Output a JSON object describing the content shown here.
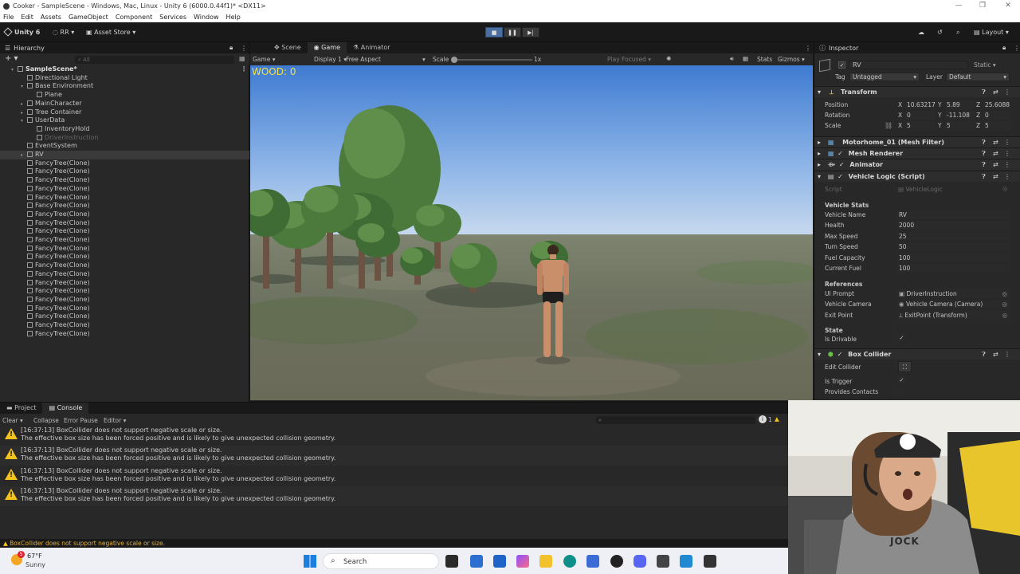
{
  "window": {
    "title": "Cooker - SampleScene - Windows, Mac, Linux - Unity 6 (6000.0.44f1)* <DX11>",
    "controls": [
      "—",
      "❐",
      "✕"
    ]
  },
  "menu": [
    "File",
    "Edit",
    "Assets",
    "GameObject",
    "Component",
    "Services",
    "Window",
    "Help"
  ],
  "toolbar": {
    "unity_label": "Unity 6",
    "account": "RR",
    "asset_store": "Asset Store",
    "layout": "Layout"
  },
  "hierarchy": {
    "tab": "Hierarchy",
    "search_placeholder": "All",
    "items": [
      {
        "label": "SampleScene*",
        "depth": 0,
        "dim": false
      },
      {
        "label": "Directional Light",
        "depth": 1,
        "dim": false
      },
      {
        "label": "Base Environment",
        "depth": 1,
        "dim": false
      },
      {
        "label": "Plane",
        "depth": 2,
        "dim": false
      },
      {
        "label": "MainCharacter",
        "depth": 1,
        "dim": false
      },
      {
        "label": "Tree Container",
        "depth": 1,
        "dim": false
      },
      {
        "label": "UserData",
        "depth": 1,
        "dim": false
      },
      {
        "label": "InventoryHold",
        "depth": 2,
        "dim": false
      },
      {
        "label": "DriverInstruction",
        "depth": 2,
        "dim": true
      },
      {
        "label": "EventSystem",
        "depth": 1,
        "dim": false
      },
      {
        "label": "RV",
        "depth": 1,
        "dim": false,
        "selected": true
      },
      {
        "label": "FancyTree(Clone)",
        "depth": 1,
        "dim": false
      },
      {
        "label": "FancyTree(Clone)",
        "depth": 1,
        "dim": false
      },
      {
        "label": "FancyTree(Clone)",
        "depth": 1,
        "dim": false
      },
      {
        "label": "FancyTree(Clone)",
        "depth": 1,
        "dim": false
      },
      {
        "label": "FancyTree(Clone)",
        "depth": 1,
        "dim": false
      },
      {
        "label": "FancyTree(Clone)",
        "depth": 1,
        "dim": false
      },
      {
        "label": "FancyTree(Clone)",
        "depth": 1,
        "dim": false
      },
      {
        "label": "FancyTree(Clone)",
        "depth": 1,
        "dim": false
      },
      {
        "label": "FancyTree(Clone)",
        "depth": 1,
        "dim": false
      },
      {
        "label": "FancyTree(Clone)",
        "depth": 1,
        "dim": false
      },
      {
        "label": "FancyTree(Clone)",
        "depth": 1,
        "dim": false
      },
      {
        "label": "FancyTree(Clone)",
        "depth": 1,
        "dim": false
      },
      {
        "label": "FancyTree(Clone)",
        "depth": 1,
        "dim": false
      },
      {
        "label": "FancyTree(Clone)",
        "depth": 1,
        "dim": false
      },
      {
        "label": "FancyTree(Clone)",
        "depth": 1,
        "dim": false
      },
      {
        "label": "FancyTree(Clone)",
        "depth": 1,
        "dim": false
      },
      {
        "label": "FancyTree(Clone)",
        "depth": 1,
        "dim": false
      },
      {
        "label": "FancyTree(Clone)",
        "depth": 1,
        "dim": false
      },
      {
        "label": "FancyTree(Clone)",
        "depth": 1,
        "dim": false
      },
      {
        "label": "FancyTree(Clone)",
        "depth": 1,
        "dim": false
      },
      {
        "label": "FancyTree(Clone)",
        "depth": 1,
        "dim": false
      }
    ]
  },
  "center_tabs": {
    "scene": "Scene",
    "game": "Game",
    "animator": "Animator"
  },
  "game_bar": {
    "mode": "Game",
    "display": "Display 1",
    "aspect": "Free Aspect",
    "scale_label": "Scale",
    "scale_value": "1x",
    "play_focused": "Play Focused",
    "stats": "Stats",
    "gizmos": "Gizmos"
  },
  "hud": {
    "wood": "WOOD: 0"
  },
  "inspector": {
    "tab": "Inspector",
    "object_name": "RV",
    "static_label": "Static",
    "tag_label": "Tag",
    "tag_value": "Untagged",
    "layer_label": "Layer",
    "layer_value": "Default",
    "transform": {
      "title": "Transform",
      "position_label": "Position",
      "rotation_label": "Rotation",
      "scale_label": "Scale",
      "position": [
        "10.63217",
        "5.89",
        "25.6088"
      ],
      "rotation": [
        "0",
        "-11.108",
        "0"
      ],
      "scale": [
        "5",
        "5",
        "5"
      ]
    },
    "components": [
      "Motorhome_01 (Mesh Filter)",
      "Mesh Renderer",
      "Animator",
      "Vehicle Logic (Script)",
      "Box Collider"
    ],
    "script_label": "Script",
    "script_value": "VehicleLogic",
    "vehicle_stats_header": "Vehicle Stats",
    "stats": [
      {
        "label": "Vehicle Name",
        "value": "RV"
      },
      {
        "label": "Health",
        "value": "2000"
      },
      {
        "label": "Max Speed",
        "value": "25"
      },
      {
        "label": "Turn Speed",
        "value": "50"
      },
      {
        "label": "Fuel Capacity",
        "value": "100"
      },
      {
        "label": "Current Fuel",
        "value": "100"
      }
    ],
    "references_header": "References",
    "references": [
      {
        "label": "UI Prompt",
        "value": "DriverInstruction"
      },
      {
        "label": "Vehicle Camera",
        "value": "Vehicle Camera (Camera)"
      },
      {
        "label": "Exit Point",
        "value": "ExitPoint (Transform)"
      }
    ],
    "state_header": "State",
    "is_drivable_label": "Is Drivable",
    "box_collider": {
      "edit_collider": "Edit Collider",
      "is_trigger": "Is Trigger",
      "provides_contacts": "Provides Contacts"
    }
  },
  "bottom_tabs": {
    "project": "Project",
    "console": "Console"
  },
  "console": {
    "clear": "Clear",
    "collapse": "Collapse",
    "error_pause": "Error Pause",
    "editor": "Editor",
    "warn_count": "1",
    "logs": [
      {
        "line1": "[16:37:13] BoxCollider does not support negative scale or size.",
        "line2": "The effective box size has been forced positive and is likely to give unexpected collision geometry."
      },
      {
        "line1": "[16:37:13] BoxCollider does not support negative scale or size.",
        "line2": "The effective box size has been forced positive and is likely to give unexpected collision geometry."
      },
      {
        "line1": "[16:37:13] BoxCollider does not support negative scale or size.",
        "line2": "The effective box size has been forced positive and is likely to give unexpected collision geometry."
      },
      {
        "line1": "[16:37:13] BoxCollider does not support negative scale or size.",
        "line2": "The effective box size has been forced positive and is likely to give unexpected collision geometry."
      }
    ],
    "status": "BoxCollider does not support negative scale or size."
  },
  "taskbar": {
    "temp": "67°F",
    "weather": "Sunny",
    "search": "Search",
    "notif_count": "5"
  },
  "webcam": {
    "shirt_text": "JOCK"
  }
}
